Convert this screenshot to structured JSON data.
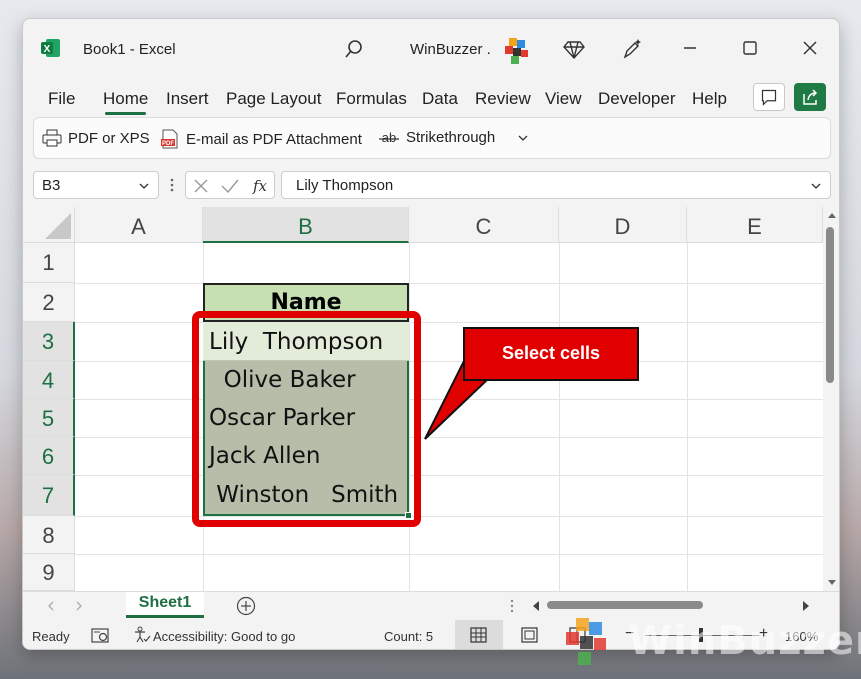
{
  "window": {
    "app_title": "Book1  -  Excel",
    "user": "WinBuzzer ."
  },
  "menu": [
    "File",
    "Home",
    "Insert",
    "Page Layout",
    "Formulas",
    "Data",
    "Review",
    "View",
    "Developer",
    "Help"
  ],
  "ribbon": {
    "pdf_xps": "PDF or XPS",
    "email_pdf": "E-mail as PDF Attachment",
    "strikethrough": "Strikethrough"
  },
  "formula_bar": {
    "name_box": "B3",
    "formula": "Lily  Thompson"
  },
  "grid": {
    "columns": [
      "A",
      "B",
      "C",
      "D",
      "E"
    ],
    "rows": [
      "1",
      "2",
      "3",
      "4",
      "5",
      "6",
      "7",
      "8",
      "9"
    ],
    "header_cell": "Name",
    "names": [
      "Lily  Thompson",
      "  Olive Baker",
      "Oscar Parker",
      "Jack Allen",
      " Winston   Smith"
    ]
  },
  "callout": "Select cells",
  "sheet_tab": "Sheet1",
  "status": {
    "ready": "Ready",
    "accessibility": "Accessibility: Good to go",
    "count": "Count: 5",
    "zoom": "160%"
  },
  "watermark": "WinBuzzer",
  "colors": {
    "excel_green": "#1e6f42",
    "header_fill": "#c6e0b4",
    "selection_fill": "#b6bea9",
    "highlight_red": "#e00000"
  }
}
